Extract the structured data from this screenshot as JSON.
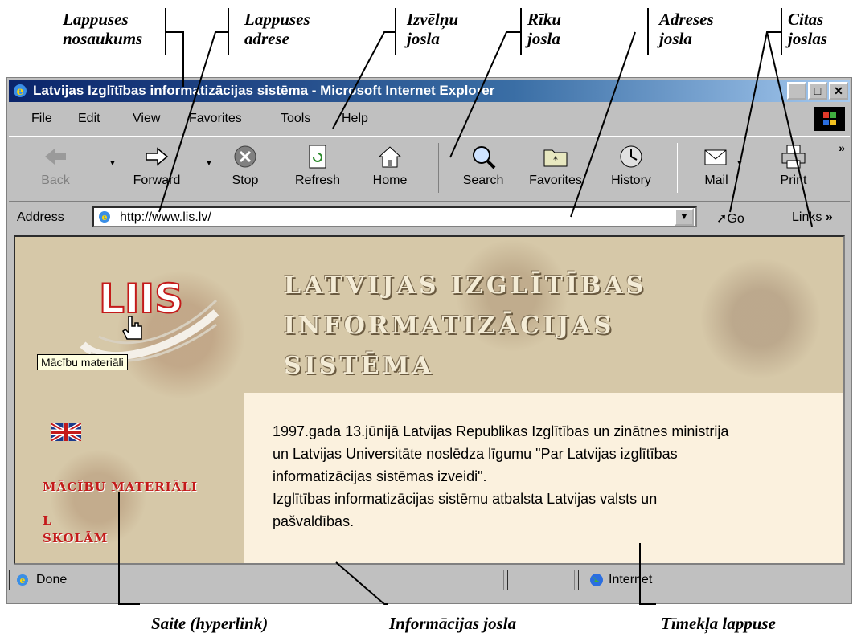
{
  "callouts": {
    "lappuses_nosaukums": [
      "Lappuses",
      "nosaukums"
    ],
    "lappuses_adrese": [
      "Lappuses",
      "adrese"
    ],
    "izvelnu_josla": [
      "Izvēlņu",
      "josla"
    ],
    "riku_josla": [
      "Rīku",
      "josla"
    ],
    "adreses_josla": [
      "Adreses",
      "josla"
    ],
    "citas_joslas": [
      "Citas",
      "joslas"
    ],
    "saite": "Saite (hyperlink)",
    "informacijas_josla": "Informācijas josla",
    "timekla_lappuse": "Tīmekļa lappuse"
  },
  "window": {
    "title": "Latvijas Izglītības informatizācijas sistēma - Microsoft Internet Explorer"
  },
  "menu": [
    "File",
    "Edit",
    "View",
    "Favorites",
    "Tools",
    "Help"
  ],
  "toolbar": {
    "buttons": [
      {
        "label": "Back",
        "icon": "back-arrow-icon",
        "enabled": false
      },
      {
        "label": "Forward",
        "icon": "forward-arrow-icon",
        "enabled": true
      },
      {
        "label": "Stop",
        "icon": "stop-icon",
        "enabled": true
      },
      {
        "label": "Refresh",
        "icon": "refresh-icon",
        "enabled": true
      },
      {
        "label": "Home",
        "icon": "home-icon",
        "enabled": true
      },
      {
        "label": "Search",
        "icon": "search-icon",
        "enabled": true
      },
      {
        "label": "Favorites",
        "icon": "favorites-folder-icon",
        "enabled": true
      },
      {
        "label": "History",
        "icon": "history-icon",
        "enabled": true
      },
      {
        "label": "Mail",
        "icon": "mail-icon",
        "enabled": true
      },
      {
        "label": "Print",
        "icon": "print-icon",
        "enabled": true
      }
    ]
  },
  "address": {
    "label": "Address",
    "url": "http://www.lis.lv/",
    "go": "Go",
    "links": "Links"
  },
  "page": {
    "logo_text": "LIIS",
    "heading": [
      "LATVIJAS IZGLĪTĪBAS",
      "INFORMATIZĀCIJAS",
      "SISTĒMA"
    ],
    "content": [
      "1997.gada 13.jūnijā Latvijas Republikas Izglītības un zinātnes ministrija un Latvijas Universitāte noslēdza līgumu \"Par Latvijas izglītības informatizācijas sistēmas izveidi\".",
      "Izglītības informatizācijas sistēmu atbalsta Latvijas valsts un pašvaldības."
    ],
    "link_materials": "MĀCĪBU MATERIĀLI",
    "link_schools_1": "L",
    "link_schools_2": "SKOLĀM",
    "tooltip": "Mācību materiāli"
  },
  "status": {
    "text": "Done",
    "zone": "Internet"
  },
  "colors": {
    "titlebar": "#0a246a",
    "chrome": "#c0c0c0",
    "link_red": "#c41a1a",
    "page_bg": "#d6c8a8",
    "content_bg": "#fbf1de"
  }
}
